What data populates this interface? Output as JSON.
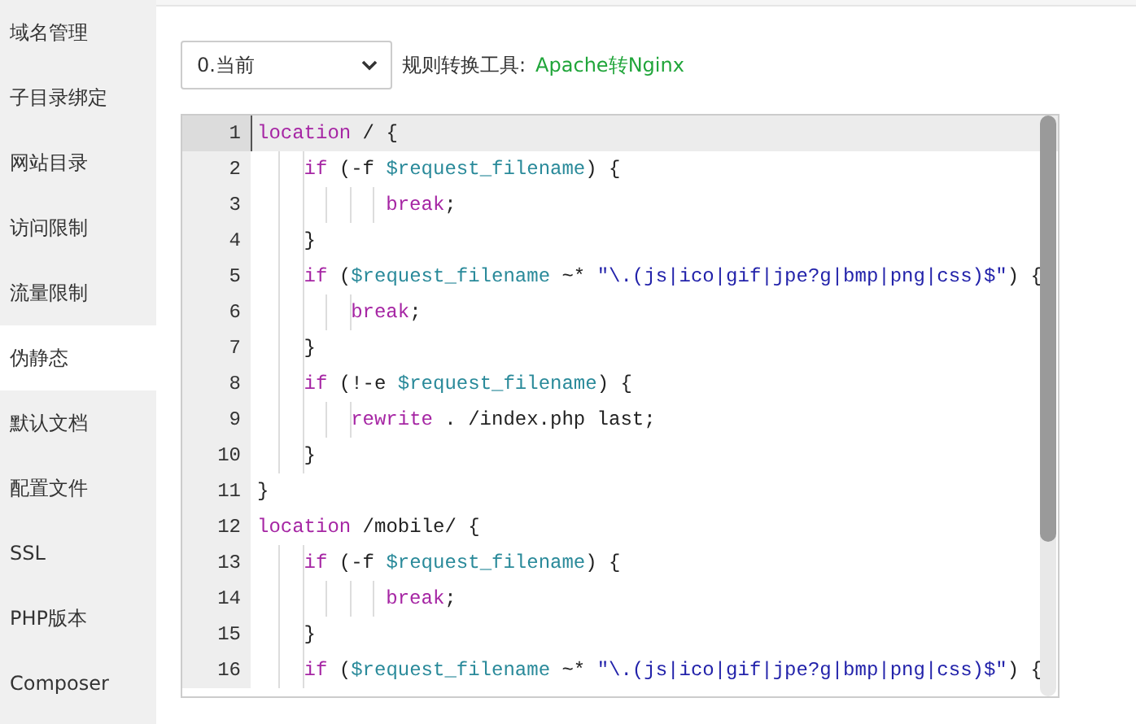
{
  "sidebar": {
    "items": [
      {
        "label": "域名管理",
        "selected": false
      },
      {
        "label": "子目录绑定",
        "selected": false
      },
      {
        "label": "网站目录",
        "selected": false
      },
      {
        "label": "访问限制",
        "selected": false
      },
      {
        "label": "流量限制",
        "selected": false
      },
      {
        "label": "伪静态",
        "selected": true
      },
      {
        "label": "默认文档",
        "selected": false
      },
      {
        "label": "配置文件",
        "selected": false
      },
      {
        "label": "SSL",
        "selected": false
      },
      {
        "label": "PHP版本",
        "selected": false
      },
      {
        "label": "Composer",
        "selected": false
      }
    ]
  },
  "toolbar": {
    "version_select": {
      "value": "0.当前"
    },
    "tool_label": "规则转换工具:",
    "tool_link": "Apache转Nginx"
  },
  "editor": {
    "lines": [
      {
        "number": "1",
        "active": true,
        "tokens": [
          {
            "kind": "keyword",
            "text": "location"
          },
          {
            "kind": "plain",
            "text": " / {"
          }
        ]
      },
      {
        "number": "2",
        "active": false,
        "tokens": [
          {
            "kind": "indent",
            "steps": [
              {
                "line": true
              },
              {
                "line": true
              }
            ]
          },
          {
            "kind": "keyword",
            "text": "if"
          },
          {
            "kind": "plain",
            "text": " (-f "
          },
          {
            "kind": "variable",
            "text": "$request_filename"
          },
          {
            "kind": "plain",
            "text": ") {"
          }
        ]
      },
      {
        "number": "3",
        "active": false,
        "tokens": [
          {
            "kind": "indent",
            "steps": [
              {
                "line": true
              },
              {
                "line": true
              },
              {
                "line": true
              },
              {
                "line": true
              },
              {
                "line": true
              },
              {
                "line": false
              }
            ]
          },
          {
            "kind": "keyword",
            "text": "break"
          },
          {
            "kind": "plain",
            "text": ";"
          }
        ]
      },
      {
        "number": "4",
        "active": false,
        "tokens": [
          {
            "kind": "indent",
            "steps": [
              {
                "line": true
              },
              {
                "line": true
              }
            ]
          },
          {
            "kind": "plain",
            "text": "}"
          }
        ]
      },
      {
        "number": "5",
        "active": false,
        "tokens": [
          {
            "kind": "indent",
            "steps": [
              {
                "line": true
              },
              {
                "line": true
              }
            ]
          },
          {
            "kind": "keyword",
            "text": "if"
          },
          {
            "kind": "plain",
            "text": " ("
          },
          {
            "kind": "variable",
            "text": "$request_filename"
          },
          {
            "kind": "plain",
            "text": " ~* "
          },
          {
            "kind": "string",
            "text": "\"\\.(js|ico|gif|jpe?g|bmp|png|css)$\""
          },
          {
            "kind": "plain",
            "text": ") {"
          }
        ]
      },
      {
        "number": "6",
        "active": false,
        "tokens": [
          {
            "kind": "indent",
            "steps": [
              {
                "line": true
              },
              {
                "line": true
              },
              {
                "line": true
              },
              {
                "line": true
              }
            ]
          },
          {
            "kind": "keyword",
            "text": "break"
          },
          {
            "kind": "plain",
            "text": ";"
          }
        ]
      },
      {
        "number": "7",
        "active": false,
        "tokens": [
          {
            "kind": "indent",
            "steps": [
              {
                "line": true
              },
              {
                "line": true
              }
            ]
          },
          {
            "kind": "plain",
            "text": "}"
          }
        ]
      },
      {
        "number": "8",
        "active": false,
        "tokens": [
          {
            "kind": "indent",
            "steps": [
              {
                "line": true
              },
              {
                "line": true
              }
            ]
          },
          {
            "kind": "keyword",
            "text": "if"
          },
          {
            "kind": "plain",
            "text": " (!-e "
          },
          {
            "kind": "variable",
            "text": "$request_filename"
          },
          {
            "kind": "plain",
            "text": ") {"
          }
        ]
      },
      {
        "number": "9",
        "active": false,
        "tokens": [
          {
            "kind": "indent",
            "steps": [
              {
                "line": true
              },
              {
                "line": true
              },
              {
                "line": true
              },
              {
                "line": true
              }
            ]
          },
          {
            "kind": "keyword",
            "text": "rewrite"
          },
          {
            "kind": "plain",
            "text": " . /index.php last;"
          }
        ]
      },
      {
        "number": "10",
        "active": false,
        "tokens": [
          {
            "kind": "indent",
            "steps": [
              {
                "line": true
              },
              {
                "line": true
              }
            ]
          },
          {
            "kind": "plain",
            "text": "}"
          }
        ]
      },
      {
        "number": "11",
        "active": false,
        "tokens": [
          {
            "kind": "plain",
            "text": "}"
          }
        ]
      },
      {
        "number": "12",
        "active": false,
        "tokens": [
          {
            "kind": "keyword",
            "text": "location"
          },
          {
            "kind": "plain",
            "text": " /mobile/ {"
          }
        ]
      },
      {
        "number": "13",
        "active": false,
        "tokens": [
          {
            "kind": "indent",
            "steps": [
              {
                "line": true
              },
              {
                "line": true
              }
            ]
          },
          {
            "kind": "keyword",
            "text": "if"
          },
          {
            "kind": "plain",
            "text": " (-f "
          },
          {
            "kind": "variable",
            "text": "$request_filename"
          },
          {
            "kind": "plain",
            "text": ") {"
          }
        ]
      },
      {
        "number": "14",
        "active": false,
        "tokens": [
          {
            "kind": "indent",
            "steps": [
              {
                "line": true
              },
              {
                "line": true
              },
              {
                "line": true
              },
              {
                "line": true
              },
              {
                "line": true
              },
              {
                "line": false
              }
            ]
          },
          {
            "kind": "keyword",
            "text": "break"
          },
          {
            "kind": "plain",
            "text": ";"
          }
        ]
      },
      {
        "number": "15",
        "active": false,
        "tokens": [
          {
            "kind": "indent",
            "steps": [
              {
                "line": true
              },
              {
                "line": true
              }
            ]
          },
          {
            "kind": "plain",
            "text": "}"
          }
        ]
      },
      {
        "number": "16",
        "active": false,
        "tokens": [
          {
            "kind": "indent",
            "steps": [
              {
                "line": true
              },
              {
                "line": true
              }
            ]
          },
          {
            "kind": "keyword",
            "text": "if"
          },
          {
            "kind": "plain",
            "text": " ("
          },
          {
            "kind": "variable",
            "text": "$request_filename"
          },
          {
            "kind": "plain",
            "text": " ~* "
          },
          {
            "kind": "string",
            "text": "\"\\.(js|ico|gif|jpe?g|bmp|png|css)$\""
          },
          {
            "kind": "plain",
            "text": ") {"
          }
        ]
      }
    ]
  }
}
